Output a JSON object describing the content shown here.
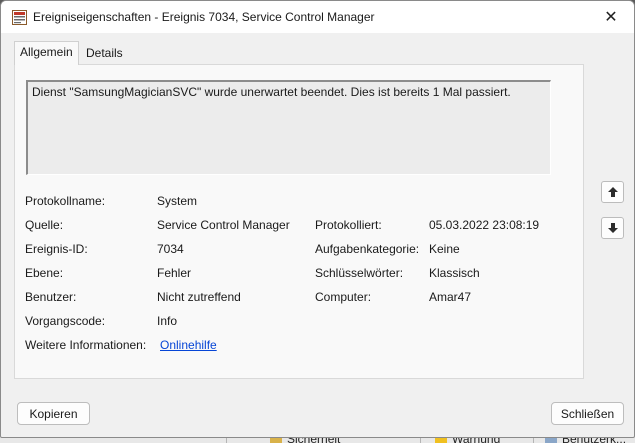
{
  "window": {
    "title": "Ereigniseigenschaften - Ereignis 7034, Service Control Manager",
    "close_glyph": "✕"
  },
  "tabs": [
    {
      "label": "Allgemein",
      "active": true
    },
    {
      "label": "Details",
      "active": false
    }
  ],
  "description": "Dienst \"SamsungMagicianSVC\" wurde unerwartet beendet. Dies ist bereits 1 Mal passiert.",
  "fields": {
    "protokollname": {
      "label": "Protokollname:",
      "value": "System"
    },
    "quelle": {
      "label": "Quelle:",
      "value": "Service Control Manager"
    },
    "ereignis_id": {
      "label": "Ereignis-ID:",
      "value": "7034"
    },
    "ebene": {
      "label": "Ebene:",
      "value": "Fehler"
    },
    "benutzer": {
      "label": "Benutzer:",
      "value": "Nicht zutreffend"
    },
    "vorgangscode": {
      "label": "Vorgangscode:",
      "value": "Info"
    },
    "weitere_info": {
      "label": "Weitere Informationen:",
      "value": "Onlinehilfe"
    },
    "protokolliert": {
      "label": "Protokolliert:",
      "value": "05.03.2022 23:08:19"
    },
    "aufgabenkategorie": {
      "label": "Aufgabenkategorie:",
      "value": "Keine"
    },
    "schluesselwoerter": {
      "label": "Schlüsselwörter:",
      "value": "Klassisch"
    },
    "computer": {
      "label": "Computer:",
      "value": "Amar47"
    }
  },
  "buttons": {
    "copy": "Kopieren",
    "close": "Schließen"
  },
  "background": {
    "item1": "Sicherheit",
    "item2": "Warnung",
    "item3": "Benutzerk..."
  },
  "colors": {
    "link": "#0645d6",
    "panel": "#f9f9f9"
  },
  "icons": {
    "app": "event-viewer-icon",
    "up": "arrow-up-icon",
    "down": "arrow-down-icon"
  }
}
